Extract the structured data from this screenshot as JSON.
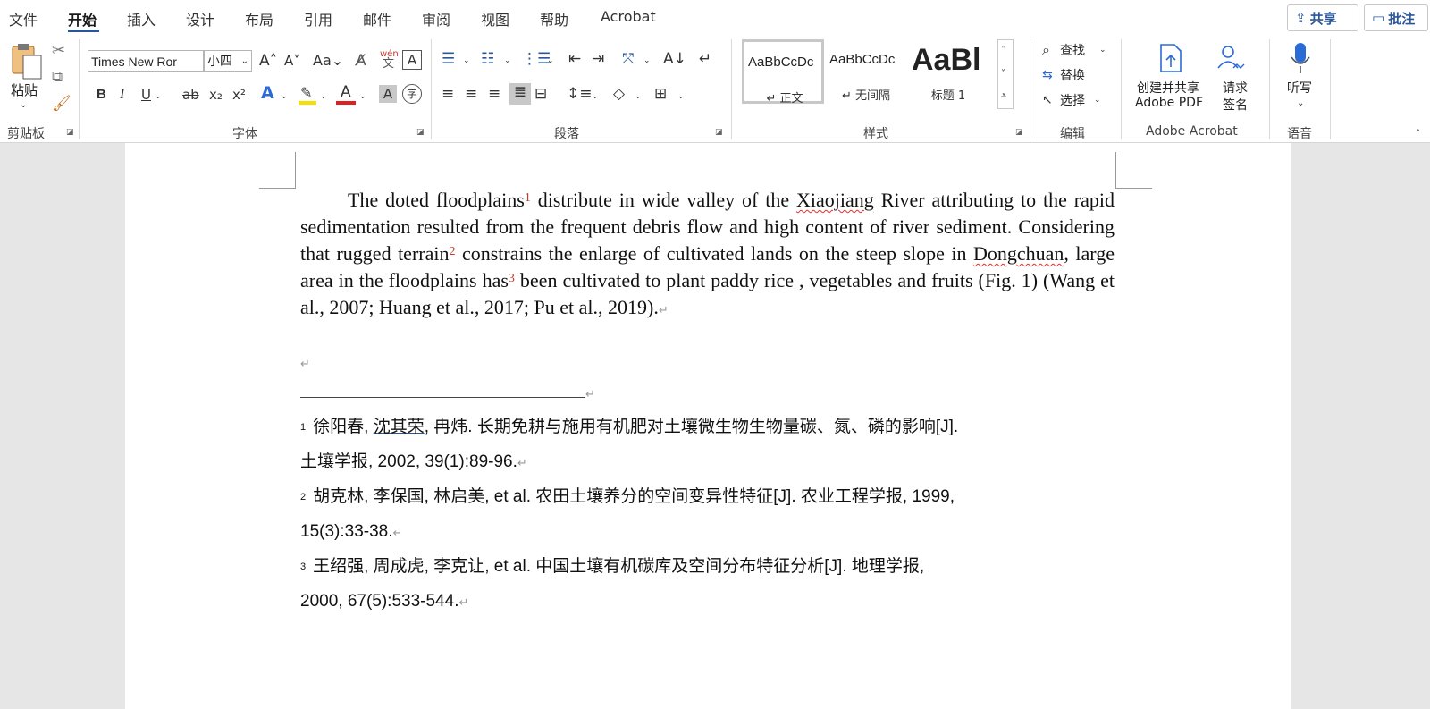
{
  "tabs": [
    "文件",
    "开始",
    "插入",
    "设计",
    "布局",
    "引用",
    "邮件",
    "审阅",
    "视图",
    "帮助",
    "Acrobat"
  ],
  "top_buttons": {
    "share": "共享",
    "comments": "批注"
  },
  "ribbon": {
    "clipboard": {
      "paste": "粘贴",
      "label": "剪贴板"
    },
    "font": {
      "name": "Times New Ror",
      "size": "小四",
      "label": "字体",
      "change_case": "Aa",
      "phonetic_top": "wén",
      "phonetic_bottom": "文",
      "buttons": [
        "B",
        "I",
        "U",
        "ab",
        "x₂",
        "x²"
      ]
    },
    "paragraph": {
      "label": "段落"
    },
    "styles": {
      "label": "样式",
      "items": [
        {
          "sample": "AaBbCcDc",
          "name": "↵ 正文"
        },
        {
          "sample": "AaBbCcDc",
          "name": "↵ 无间隔"
        },
        {
          "sample": "AaBl",
          "name": "标题 1"
        }
      ]
    },
    "editing": {
      "label": "编辑",
      "find": "查找",
      "replace": "替换",
      "select": "选择"
    },
    "acrobat": {
      "label": "Adobe Acrobat",
      "create_line1": "创建并共享",
      "create_line2": "Adobe PDF",
      "request_line1": "请求",
      "request_line2": "签名"
    },
    "voice": {
      "label": "语音",
      "dictate": "听写"
    }
  },
  "document": {
    "para": {
      "t1": "The doted floodplains",
      "s1": "1",
      "t2": "  distribute in wide valley of the ",
      "w1": "Xiaojiang",
      "t3": " River attributing to the rapid sedimentation resulted from the frequent debris flow and high content of river sediment. Considering that rugged terrain",
      "s2": "2",
      "t4": "  constrains the enlarge of cultivated lands on the steep slope in ",
      "w2": "Dongchuan",
      "t5": ", large area in the floodplains has",
      "s3": "3",
      "t6": "  been cultivated to plant paddy rice , vegetables and fruits (Fig. 1) (Wang et al., 2007; Huang et al., 2017; Pu et al., 2019).",
      "mark": "↵"
    },
    "footnotes": [
      {
        "num": "1",
        "pre": "徐阳春, ",
        "link": "沈其荣",
        "post": ", 冉炜.  长期免耕与施用有机肥对土壤微生物生物量碳、氮、磷的影响[J].",
        "line2": "土壤学报, 2002, 39(1):89-96."
      },
      {
        "num": "2",
        "text": "胡克林, 李保国, 林启美, et al.  农田土壤养分的空间变异性特征[J].  农业工程学报, 1999,",
        "line2": "15(3):33-38."
      },
      {
        "num": "3",
        "text": "王绍强, 周成虎, 李克让, et al.  中国土壤有机碳库及空间分布特征分析[J].  地理学报,",
        "line2": "2000, 67(5):533-544."
      }
    ]
  }
}
